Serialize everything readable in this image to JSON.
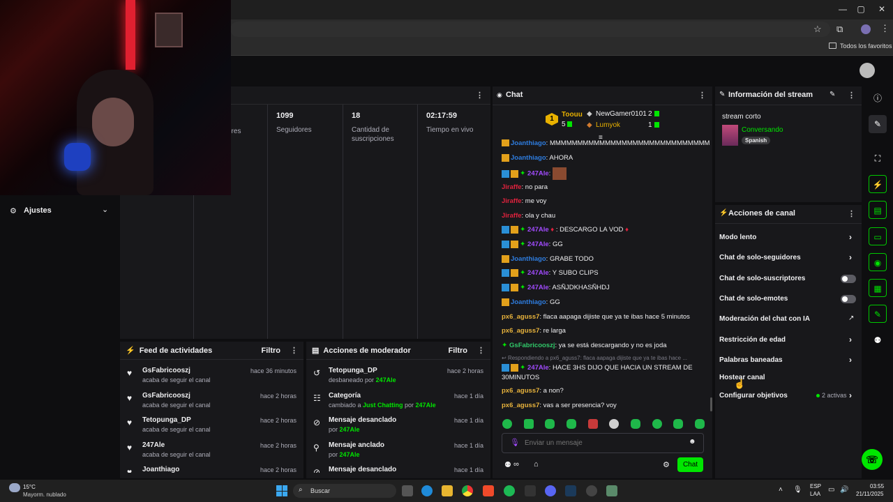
{
  "browser": {
    "favorites_label": "Todos los favoritos"
  },
  "settings": {
    "label": "Ajustes"
  },
  "stats": [
    {
      "value": "",
      "label": "ores"
    },
    {
      "value": "1099",
      "label": "Seguidores"
    },
    {
      "value": "18",
      "label": "Cantidad de suscripciones"
    },
    {
      "value": "02:17:59",
      "label": "Tiempo en vivo"
    }
  ],
  "feed": {
    "title": "Feed de actividades",
    "filter": "Filtro",
    "items": [
      {
        "name": "GsFabricooszj",
        "sub": "acaba de seguir el canal",
        "time": "hace 36 minutos"
      },
      {
        "name": "GsFabricooszj",
        "sub": "acaba de seguir el canal",
        "time": "hace 2 horas"
      },
      {
        "name": "Tetopunga_DP",
        "sub": "acaba de seguir el canal",
        "time": "hace 2 horas"
      },
      {
        "name": "247Ale",
        "sub": "acaba de seguir el canal",
        "time": "hace 2 horas"
      },
      {
        "name": "Joanthiago",
        "sub": "",
        "time": "hace 2 horas"
      }
    ]
  },
  "mod": {
    "title": "Acciones de moderador",
    "filter": "Filtro",
    "items": [
      {
        "name": "Tetopunga_DP",
        "sub_pre": "desbaneado por ",
        "sub_user": "247Ale",
        "sub_mid": "",
        "sub_user2": "",
        "time": "hace 2 horas",
        "icon": "↺"
      },
      {
        "name": "Categoría",
        "sub_pre": "cambiado a ",
        "sub_user": "Just Chatting",
        "sub_mid": " por ",
        "sub_user2": "247Ale",
        "time": "hace 1 día",
        "icon": "☷"
      },
      {
        "name": "Mensaje desanclado",
        "sub_pre": "por ",
        "sub_user": "247Ale",
        "sub_mid": "",
        "sub_user2": "",
        "time": "hace 1 día",
        "icon": "⊘"
      },
      {
        "name": "Mensaje anclado",
        "sub_pre": "por ",
        "sub_user": "247Ale",
        "sub_mid": "",
        "sub_user2": "",
        "time": "hace 1 día",
        "icon": "⚲"
      },
      {
        "name": "Mensaje desanclado",
        "sub_pre": "",
        "sub_user": "",
        "sub_mid": "",
        "sub_user2": "",
        "time": "hace 1 día",
        "icon": "⊘"
      }
    ]
  },
  "chat": {
    "title": "Chat",
    "leader": {
      "name": "Toouu",
      "count": "5",
      "rank": "1"
    },
    "gifters": [
      {
        "name": "NewGamer0101",
        "count": "2"
      },
      {
        "name": "Lumyok",
        "count": "1"
      }
    ],
    "messages": [
      {
        "user": "Joanthiago",
        "color": "#2e7de0",
        "text": ": MMMMMMMMMMMMMMMMMMMMMMMMMMMMM"
      },
      {
        "user": "Joanthiago",
        "color": "#2e7de0",
        "text": ": AHORA"
      },
      {
        "user": "247Ale",
        "color": "#a24bff",
        "text": ":"
      },
      {
        "user": "Jiraffe",
        "color": "#e0223d",
        "text": ": no para"
      },
      {
        "user": "Jiraffe",
        "color": "#e0223d",
        "text": ": me voy"
      },
      {
        "user": "Jiraffe",
        "color": "#e0223d",
        "text": ": ola y chau"
      },
      {
        "user": "247Ale",
        "color": "#a24bff",
        "text": ": DESCARGO LA VOD"
      },
      {
        "user": "247Ale",
        "color": "#a24bff",
        "text": ": GG"
      },
      {
        "user": "Joanthiago",
        "color": "#2e7de0",
        "text": ": GRABE TODO"
      },
      {
        "user": "247Ale",
        "color": "#a24bff",
        "text": ": Y SUBO CLIPS"
      },
      {
        "user": "247Ale",
        "color": "#a24bff",
        "text": ": ASÑJDKHASÑHDJ"
      },
      {
        "user": "Joanthiago",
        "color": "#2e7de0",
        "text": ": GG"
      },
      {
        "user": "px6_aguss7",
        "color": "#e8b33c",
        "text": ": flaca aapaga dijiste que ya te ibas hace 5 minutos"
      },
      {
        "user": "px6_aguss7",
        "color": "#e8b33c",
        "text": ": re larga"
      },
      {
        "user": "GsFabricooszj",
        "color": "#31c96a",
        "text": ": ya se está descargando y no es joda"
      }
    ],
    "reply_hint": "Respondiendo a px6_aguss7: flaca aapaga dijiste que ya te ibas hace ...",
    "reply_msg": {
      "user": "247Ale",
      "text": ": HACE 3HS DIJO QUE HACIA UN STREAM DE 30MINUTOS"
    },
    "after": [
      {
        "user": "px6_aguss7",
        "text": ": a non?"
      },
      {
        "user": "px6_aguss7",
        "text": ": vas a ser presencia? voy"
      }
    ],
    "placeholder": "Enviar un mensaje",
    "send": "Chat"
  },
  "stream_info": {
    "title": "Información del stream",
    "stream_title": "stream corto",
    "category": "Conversando",
    "language": "Spanish"
  },
  "actions": {
    "title": "Acciones de canal",
    "items": [
      {
        "label": "Modo lento",
        "kind": "chevron"
      },
      {
        "label": "Chat de solo-seguidores",
        "kind": "chevron"
      },
      {
        "label": "Chat de solo-suscriptores",
        "kind": "toggle"
      },
      {
        "label": "Chat de solo-emotes",
        "kind": "toggle"
      },
      {
        "label": "Moderación del chat con IA",
        "kind": "chart"
      },
      {
        "label": "Restricción de edad",
        "kind": "chevron"
      },
      {
        "label": "Palabras baneadas",
        "kind": "chevron"
      },
      {
        "label": "Hostear canal",
        "kind": "none"
      },
      {
        "label": "Configurar objetivos",
        "kind": "chevron"
      }
    ],
    "goals_active": "2 activas"
  },
  "taskbar": {
    "weather_temp": "15°C",
    "weather_desc": "Mayorm. nublado",
    "search": "Buscar",
    "lang1": "ESP",
    "lang2": "LAA",
    "time": "03:55",
    "date": "21/11/2025"
  },
  "colors": {
    "accent": "#00e600",
    "mod": "#00e600"
  }
}
